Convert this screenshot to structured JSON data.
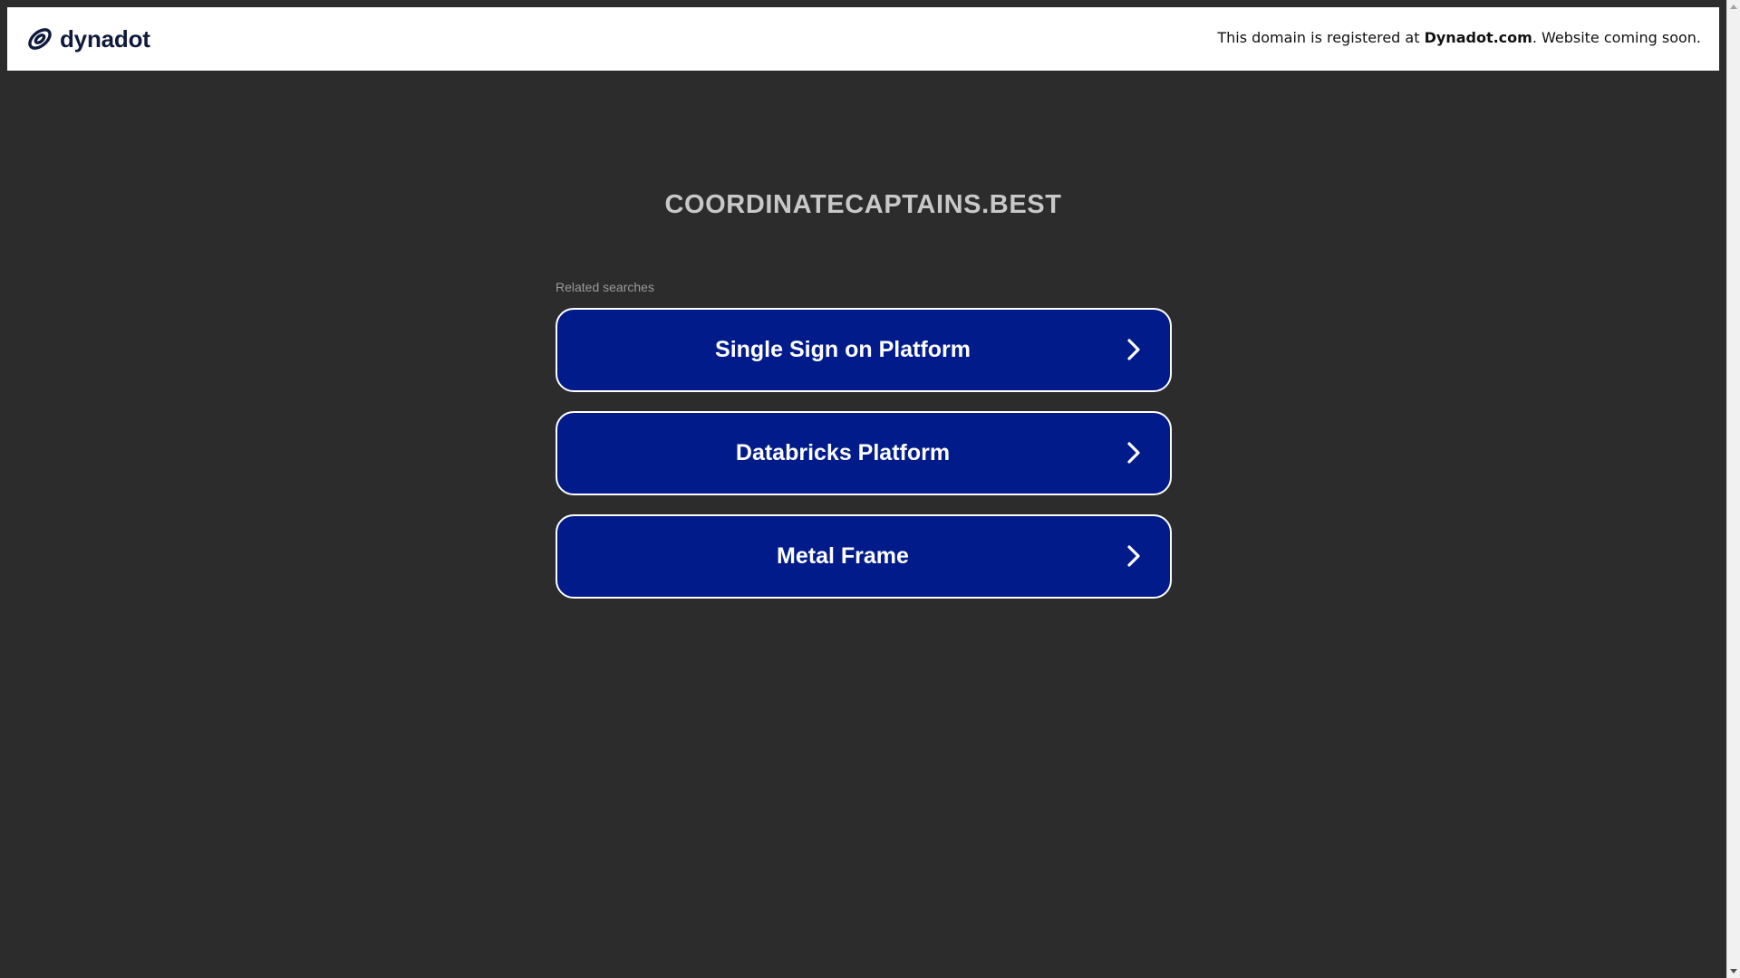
{
  "header": {
    "logo_text": "dynadot",
    "logo_icon": "dynadot-link-icon",
    "notice_prefix": "This domain is registered at ",
    "notice_brand": "Dynadot.com",
    "notice_suffix": ". Website coming soon."
  },
  "main": {
    "domain": "COORDINATECAPTAINS.BEST",
    "related_label": "Related searches",
    "links": [
      {
        "label": "Single Sign on Platform",
        "icon": "chevron-right-icon"
      },
      {
        "label": "Databricks Platform",
        "icon": "chevron-right-icon"
      },
      {
        "label": "Metal Frame",
        "icon": "chevron-right-icon"
      }
    ]
  },
  "colors": {
    "background": "#2c2c2c",
    "button_bg": "#011c8a",
    "button_border": "#ffffff",
    "title_text": "#c8c8c8",
    "logo_color": "#0f1a3c"
  }
}
